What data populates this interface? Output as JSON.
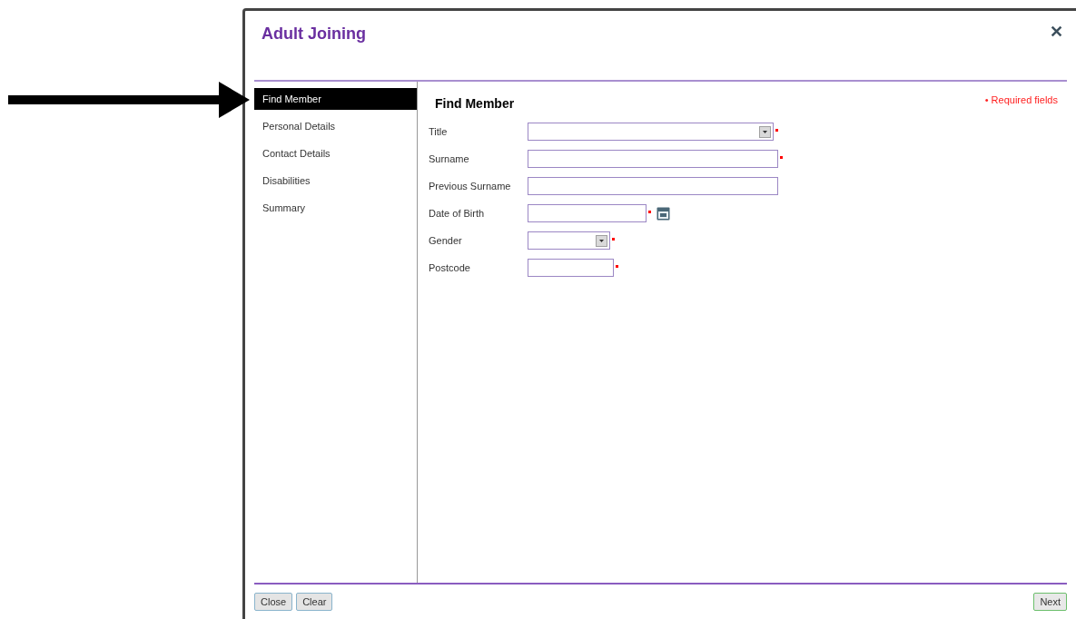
{
  "dialog": {
    "title": "Adult Joining",
    "close": "✕"
  },
  "steps": [
    {
      "label": "Find Member",
      "selected": true
    },
    {
      "label": "Personal Details",
      "selected": false
    },
    {
      "label": "Contact Details",
      "selected": false
    },
    {
      "label": "Disabilities",
      "selected": false
    },
    {
      "label": "Summary",
      "selected": false
    }
  ],
  "form": {
    "heading": "Find Member",
    "required_note": "• Required fields",
    "fields": [
      {
        "label": "Title",
        "kind": "select",
        "required": true
      },
      {
        "label": "Surname",
        "kind": "text",
        "required": true
      },
      {
        "label": "Previous Surname",
        "kind": "text",
        "required": false
      },
      {
        "label": "Date of Birth",
        "kind": "date",
        "required": true
      },
      {
        "label": "Gender",
        "kind": "select",
        "required": true
      },
      {
        "label": "Postcode",
        "kind": "text",
        "required": true
      }
    ]
  },
  "footer": {
    "left_buttons": [
      "Close",
      "Clear"
    ],
    "right_buttons": [
      "Next"
    ]
  }
}
